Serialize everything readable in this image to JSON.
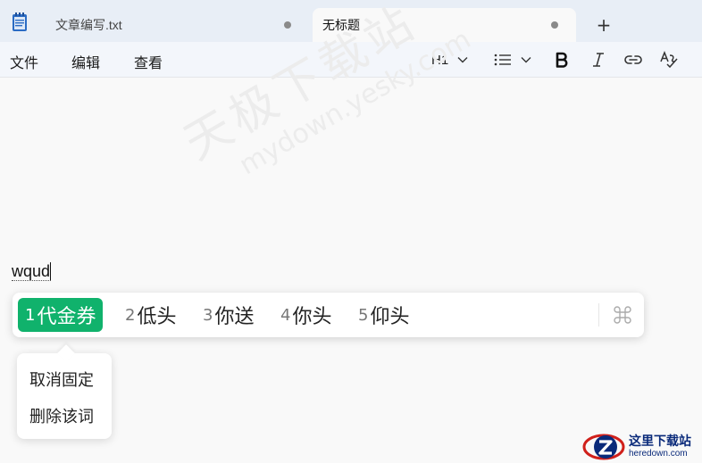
{
  "tabs": [
    {
      "title": "文章编写.txt",
      "modified": true,
      "active": false
    },
    {
      "title": "无标题",
      "modified": true,
      "active": true
    }
  ],
  "new_tab_label": "+",
  "menu": {
    "file": "文件",
    "edit": "编辑",
    "view": "查看"
  },
  "toolbar": {
    "heading_label": "H1",
    "icons": [
      "chevron-down-icon",
      "list-icon",
      "bold-icon",
      "italic-icon",
      "link-icon",
      "spellcheck-icon"
    ]
  },
  "editor": {
    "typed_text": "wqud"
  },
  "watermark": {
    "cn": "天极下载站",
    "en": "mydown.yesky.com"
  },
  "ime": {
    "candidates": [
      {
        "num": "1",
        "text": "代金券",
        "selected": true
      },
      {
        "num": "2",
        "text": "低头",
        "selected": false
      },
      {
        "num": "3",
        "text": "你送",
        "selected": false
      },
      {
        "num": "4",
        "text": "你头",
        "selected": false
      },
      {
        "num": "5",
        "text": "仰头",
        "selected": false
      }
    ],
    "accent_color": "#10b26c"
  },
  "popup": {
    "items": [
      "取消固定",
      "删除该词"
    ]
  },
  "logo": {
    "cn": "这里下载站",
    "en": "heredown.com"
  }
}
